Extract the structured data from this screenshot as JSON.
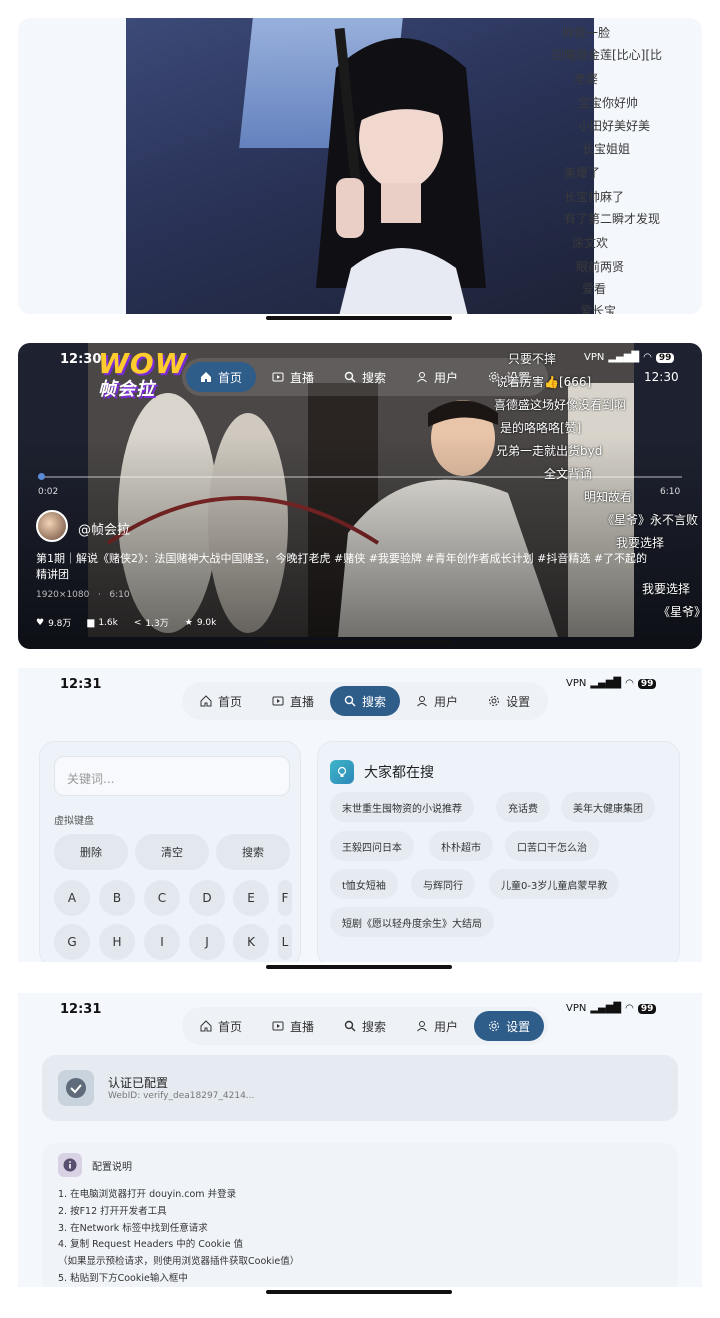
{
  "screen1": {
    "danmaku": [
      "帅我一脸",
      "田曦薇金莲[比心][比",
      "老婆",
      "宝宝你好帅",
      "小田好美好美",
      "长宝姐姐",
      "美爆了",
      "长宝帅麻了",
      "有了第二瞬才发现",
      "涂文欢",
      "眼前两贤",
      "爱看",
      "爱长宝"
    ]
  },
  "screen2": {
    "time": "12:30",
    "time_right": "12:30",
    "battery": "99",
    "logo_top": "WOW",
    "logo_bottom": "帧会拉",
    "nav": [
      "首页",
      "直播",
      "搜索",
      "用户",
      "设置"
    ],
    "danmaku": [
      "只要不摔",
      "说着厉害👍[666]",
      "喜德盛这场好像没看到啊",
      "是的咯咯咯[赞]",
      "兄弟一走就出货byd",
      "全文背诵",
      "明知故看",
      "《星爷》永不言败",
      "我要选择",
      "我要选择",
      "《星爷》"
    ],
    "time_current": "0:02",
    "time_total": "6:10",
    "author": "@帧会拉",
    "title": "第1期｜解说《赌侠2》：法国赌神大战中国赌圣，今晚打老虎 #赌侠 #我要验牌 #青年创作者成长计划 #抖音精选 #了不起的精讲团",
    "resolution": "1920×1080",
    "separator": "·",
    "duration": "6:10",
    "likes": "9.8万",
    "comments": "1.6k",
    "shares": "1.3万",
    "favorites": "9.0k"
  },
  "screen3": {
    "time": "12:31",
    "battery": "99",
    "nav": [
      "首页",
      "直播",
      "搜索",
      "用户",
      "设置"
    ],
    "search_placeholder": "关键词...",
    "keyboard_title": "虚拟键盘",
    "buttons": [
      "删除",
      "清空",
      "搜索"
    ],
    "keys_row1": [
      "A",
      "B",
      "C",
      "D",
      "E",
      "F"
    ],
    "keys_row2": [
      "G",
      "H",
      "I",
      "J",
      "K",
      "L"
    ],
    "hot_title": "大家都在搜",
    "chips": [
      "末世重生囤物资的小说推荐",
      "充话费",
      "美年大健康集团",
      "王毅四问日本",
      "朴朴超市",
      "口苦口干怎么治",
      "t恤女短袖",
      "与辉同行",
      "儿童0-3岁儿童启蒙早教",
      "短剧《愿以轻舟度余生》大结局"
    ]
  },
  "screen4": {
    "time": "12:31",
    "battery": "99",
    "nav": [
      "首页",
      "直播",
      "搜索",
      "用户",
      "设置"
    ],
    "auth_title": "认证已配置",
    "auth_sub": "WebID: verify_dea18297_4214...",
    "config_title": "配置说明",
    "steps": [
      "1. 在电脑浏览器打开 douyin.com 并登录",
      "2. 按F12 打开开发者工具",
      "3. 在Network 标签中找到任意请求",
      "4. 复制 Request Headers 中的 Cookie 值",
      "（如果显示预检请求，则使用浏览器插件获取Cookie值）",
      "5. 粘贴到下方Cookie输入框中"
    ]
  },
  "colors": {
    "accent": "#2f5d8a",
    "bg": "#f4f7fb"
  }
}
